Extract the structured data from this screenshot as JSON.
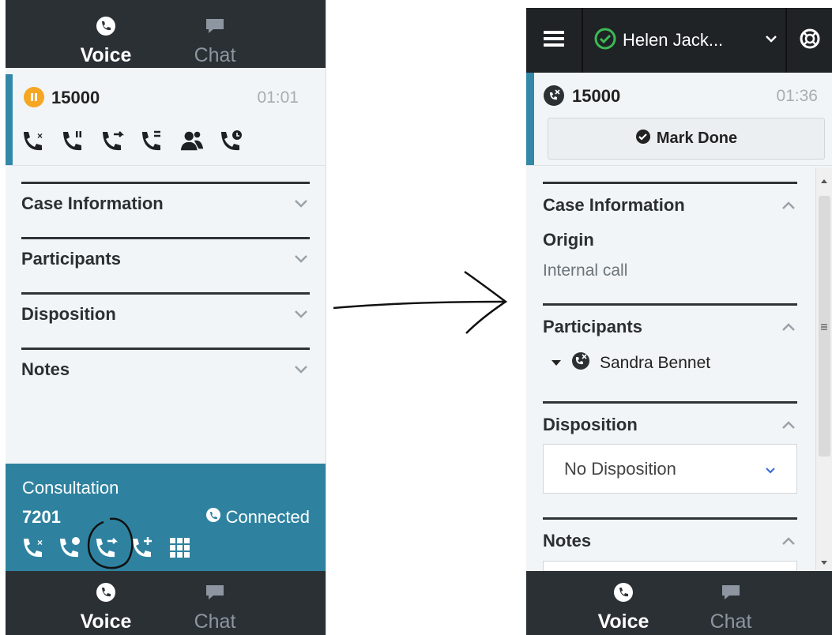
{
  "left": {
    "tabs": [
      {
        "label": "Voice",
        "icon": "phone-icon"
      },
      {
        "label": "Chat",
        "icon": "chat-bubble-icon"
      }
    ],
    "call": {
      "number": "15000",
      "time": "01:01",
      "status_icon": "on-hold-icon",
      "status_color": "#f5a623"
    },
    "actions": [
      "end-call-icon",
      "hold-call-icon",
      "transfer-call-icon",
      "consult-call-icon",
      "conference-icon",
      "schedule-callback-icon"
    ],
    "sections": [
      "Case Information",
      "Participants",
      "Disposition",
      "Notes"
    ],
    "consultation": {
      "title": "Consultation",
      "number": "7201",
      "status": "Connected",
      "actions": [
        "end-call-icon",
        "hold-call-icon",
        "transfer-call-icon",
        "add-call-icon",
        "keypad-icon"
      ]
    },
    "bottom_tabs": [
      {
        "label": "Voice",
        "icon": "phone-icon"
      },
      {
        "label": "Chat",
        "icon": "chat-bubble-icon"
      }
    ]
  },
  "right": {
    "user": {
      "name": "Helen Jack...",
      "status_color": "#3cba54"
    },
    "call": {
      "number": "15000",
      "time": "01:36"
    },
    "mark_done": "Mark Done",
    "case_information": {
      "title": "Case Information",
      "field_label": "Origin",
      "field_value": "Internal call"
    },
    "participants": {
      "title": "Participants",
      "name": "Sandra Bennet"
    },
    "disposition": {
      "title": "Disposition",
      "selected": "No Disposition"
    },
    "notes": {
      "title": "Notes"
    },
    "bottom_tabs": [
      {
        "label": "Voice",
        "icon": "phone-icon"
      },
      {
        "label": "Chat",
        "icon": "chat-bubble-icon"
      }
    ]
  },
  "colors": {
    "accent": "#3288a6",
    "dark": "#2b3035",
    "consult_bg": "#2e82a0",
    "link": "#3a6fd8"
  }
}
